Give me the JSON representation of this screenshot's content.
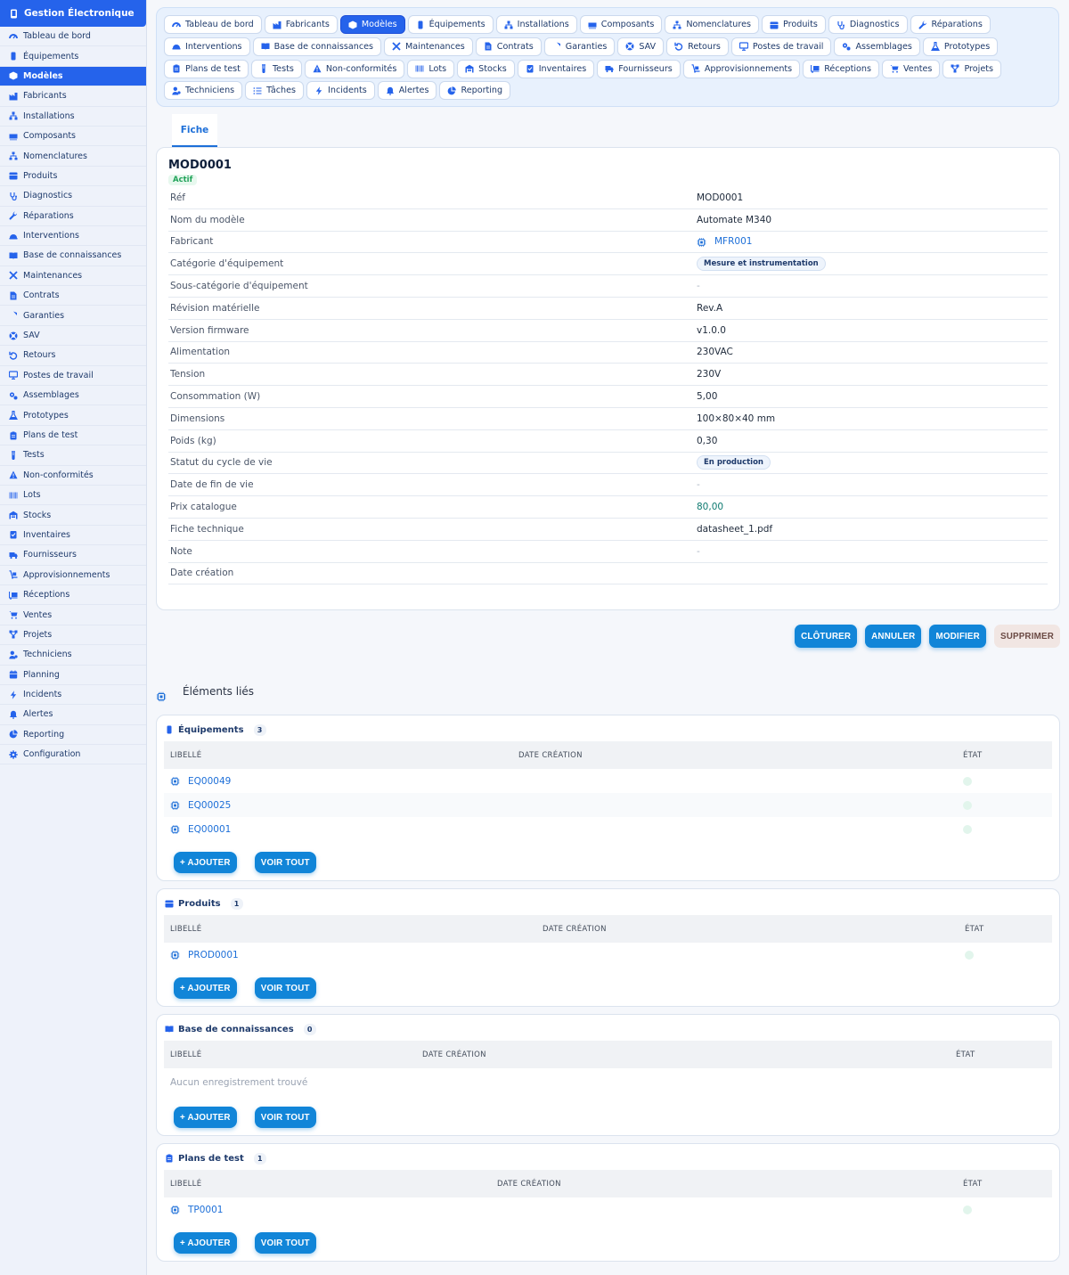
{
  "app": {
    "title": "Gestion Électronique"
  },
  "colors": {
    "accent": "#2563eb",
    "button": "#1185d8",
    "link": "#1d6fd8"
  },
  "sidebar": {
    "items": [
      {
        "label": "Tableau de bord",
        "icon": "dashboard-icon"
      },
      {
        "label": "Équipements",
        "icon": "phone-icon"
      },
      {
        "label": "Modèles",
        "icon": "box-icon",
        "active": true
      },
      {
        "label": "Fabricants",
        "icon": "factory-icon"
      },
      {
        "label": "Installations",
        "icon": "network-icon"
      },
      {
        "label": "Composants",
        "icon": "memory-icon"
      },
      {
        "label": "Nomenclatures",
        "icon": "tree-icon"
      },
      {
        "label": "Produits",
        "icon": "package-icon"
      },
      {
        "label": "Diagnostics",
        "icon": "stethoscope-icon"
      },
      {
        "label": "Réparations",
        "icon": "wrench-icon"
      },
      {
        "label": "Interventions",
        "icon": "helmet-icon"
      },
      {
        "label": "Base de connaissances",
        "icon": "book-icon"
      },
      {
        "label": "Maintenances",
        "icon": "tools-icon"
      },
      {
        "label": "Contrats",
        "icon": "contract-icon"
      },
      {
        "label": "Garanties",
        "icon": "shield-icon"
      },
      {
        "label": "SAV",
        "icon": "lifebuoy-icon"
      },
      {
        "label": "Retours",
        "icon": "undo-icon"
      },
      {
        "label": "Postes de travail",
        "icon": "monitor-icon"
      },
      {
        "label": "Assemblages",
        "icon": "gears-icon"
      },
      {
        "label": "Prototypes",
        "icon": "flask-icon"
      },
      {
        "label": "Plans de test",
        "icon": "clipboard-icon"
      },
      {
        "label": "Tests",
        "icon": "vial-icon"
      },
      {
        "label": "Non-conformités",
        "icon": "warning-icon"
      },
      {
        "label": "Lots",
        "icon": "barcode-icon"
      },
      {
        "label": "Stocks",
        "icon": "warehouse-icon"
      },
      {
        "label": "Inventaires",
        "icon": "checklist-icon"
      },
      {
        "label": "Fournisseurs",
        "icon": "truck-icon"
      },
      {
        "label": "Approvisionnements",
        "icon": "dolly-icon"
      },
      {
        "label": "Réceptions",
        "icon": "loading-icon"
      },
      {
        "label": "Ventes",
        "icon": "cart-icon"
      },
      {
        "label": "Projets",
        "icon": "diagram-icon"
      },
      {
        "label": "Techniciens",
        "icon": "user-gear-icon"
      },
      {
        "label": "Planning",
        "icon": "calendar-icon"
      },
      {
        "label": "Incidents",
        "icon": "bolt-icon"
      },
      {
        "label": "Alertes",
        "icon": "bell-icon"
      },
      {
        "label": "Reporting",
        "icon": "pie-chart-icon"
      },
      {
        "label": "Configuration",
        "icon": "gear-icon"
      }
    ]
  },
  "tabs": [
    {
      "label": "Tableau de bord",
      "icon": "dashboard-icon"
    },
    {
      "label": "Fabricants",
      "icon": "factory-icon"
    },
    {
      "label": "Modèles",
      "icon": "box-icon",
      "active": true
    },
    {
      "label": "Équipements",
      "icon": "phone-icon"
    },
    {
      "label": "Installations",
      "icon": "network-icon"
    },
    {
      "label": "Composants",
      "icon": "memory-icon"
    },
    {
      "label": "Nomenclatures",
      "icon": "tree-icon"
    },
    {
      "label": "Produits",
      "icon": "package-icon"
    },
    {
      "label": "Diagnostics",
      "icon": "stethoscope-icon"
    },
    {
      "label": "Réparations",
      "icon": "wrench-icon"
    },
    {
      "label": "Interventions",
      "icon": "helmet-icon"
    },
    {
      "label": "Base de connaissances",
      "icon": "book-icon"
    },
    {
      "label": "Maintenances",
      "icon": "tools-icon"
    },
    {
      "label": "Contrats",
      "icon": "contract-icon"
    },
    {
      "label": "Garanties",
      "icon": "shield-icon"
    },
    {
      "label": "SAV",
      "icon": "lifebuoy-icon"
    },
    {
      "label": "Retours",
      "icon": "undo-icon"
    },
    {
      "label": "Postes de travail",
      "icon": "monitor-icon"
    },
    {
      "label": "Assemblages",
      "icon": "gears-icon"
    },
    {
      "label": "Prototypes",
      "icon": "flask-icon"
    },
    {
      "label": "Plans de test",
      "icon": "clipboard-icon"
    },
    {
      "label": "Tests",
      "icon": "vial-icon"
    },
    {
      "label": "Non-conformités",
      "icon": "warning-icon"
    },
    {
      "label": "Lots",
      "icon": "barcode-icon"
    },
    {
      "label": "Stocks",
      "icon": "warehouse-icon"
    },
    {
      "label": "Inventaires",
      "icon": "checklist-icon"
    },
    {
      "label": "Fournisseurs",
      "icon": "truck-icon"
    },
    {
      "label": "Approvisionnements",
      "icon": "dolly-icon"
    },
    {
      "label": "Réceptions",
      "icon": "loading-icon"
    },
    {
      "label": "Ventes",
      "icon": "cart-icon"
    },
    {
      "label": "Projets",
      "icon": "diagram-icon"
    },
    {
      "label": "Techniciens",
      "icon": "user-gear-icon"
    },
    {
      "label": "Tâches",
      "icon": "list-icon"
    },
    {
      "label": "Incidents",
      "icon": "bolt-icon"
    },
    {
      "label": "Alertes",
      "icon": "bell-icon"
    },
    {
      "label": "Reporting",
      "icon": "pie-chart-icon"
    }
  ],
  "view_tab": "Fiche",
  "record": {
    "title": "MOD0001",
    "status": "Actif",
    "fields": [
      {
        "label": "Réf",
        "value": "MOD0001",
        "type": "text"
      },
      {
        "label": "Nom du modèle",
        "value": "Automate M340",
        "type": "text"
      },
      {
        "label": "Fabricant",
        "value": "MFR001",
        "type": "link"
      },
      {
        "label": "Catégorie d'équipement",
        "value": "Mesure et instrumentation",
        "type": "pill"
      },
      {
        "label": "Sous-catégorie d'équipement",
        "value": "-",
        "type": "dash"
      },
      {
        "label": "Révision matérielle",
        "value": "Rev.A",
        "type": "text"
      },
      {
        "label": "Version firmware",
        "value": "v1.0.0",
        "type": "text"
      },
      {
        "label": "Alimentation",
        "value": "230VAC",
        "type": "text"
      },
      {
        "label": "Tension",
        "value": "230V",
        "type": "text"
      },
      {
        "label": "Consommation (W)",
        "value": "5,00",
        "type": "text"
      },
      {
        "label": "Dimensions",
        "value": "100×80×40 mm",
        "type": "text"
      },
      {
        "label": "Poids (kg)",
        "value": "0,30",
        "type": "text"
      },
      {
        "label": "Statut du cycle de vie",
        "value": "En production",
        "type": "pill"
      },
      {
        "label": "Date de fin de vie",
        "value": "-",
        "type": "dash"
      },
      {
        "label": "Prix catalogue",
        "value": "80,00",
        "type": "money"
      },
      {
        "label": "Fiche technique",
        "value": "datasheet_1.pdf",
        "type": "text"
      },
      {
        "label": "Note",
        "value": "-",
        "type": "dash"
      },
      {
        "label": "Date création",
        "value": "",
        "type": "text"
      }
    ]
  },
  "actions": {
    "close": "CLÔTURER",
    "cancel": "ANNULER",
    "edit": "MODIFIER",
    "delete": "SUPPRIMER"
  },
  "related": {
    "title": "Éléments liés",
    "columns": {
      "label": "LIBELLÉ",
      "date": "DATE CRÉATION",
      "state": "ÉTAT"
    },
    "add_label": "+ AJOUTER",
    "view_all_label": "VOIR TOUT",
    "empty_text": "Aucun enregistrement trouvé",
    "sections": [
      {
        "title": "Équipements",
        "icon": "phone-icon",
        "count": "3",
        "rows": [
          "EQ00049",
          "EQ00025",
          "EQ00001"
        ]
      },
      {
        "title": "Produits",
        "icon": "package-icon",
        "count": "1",
        "rows": [
          "PROD0001"
        ]
      },
      {
        "title": "Base de connaissances",
        "icon": "book-icon",
        "count": "0",
        "rows": []
      },
      {
        "title": "Plans de test",
        "icon": "clipboard-icon",
        "count": "1",
        "rows": [
          "TP0001"
        ]
      }
    ]
  }
}
